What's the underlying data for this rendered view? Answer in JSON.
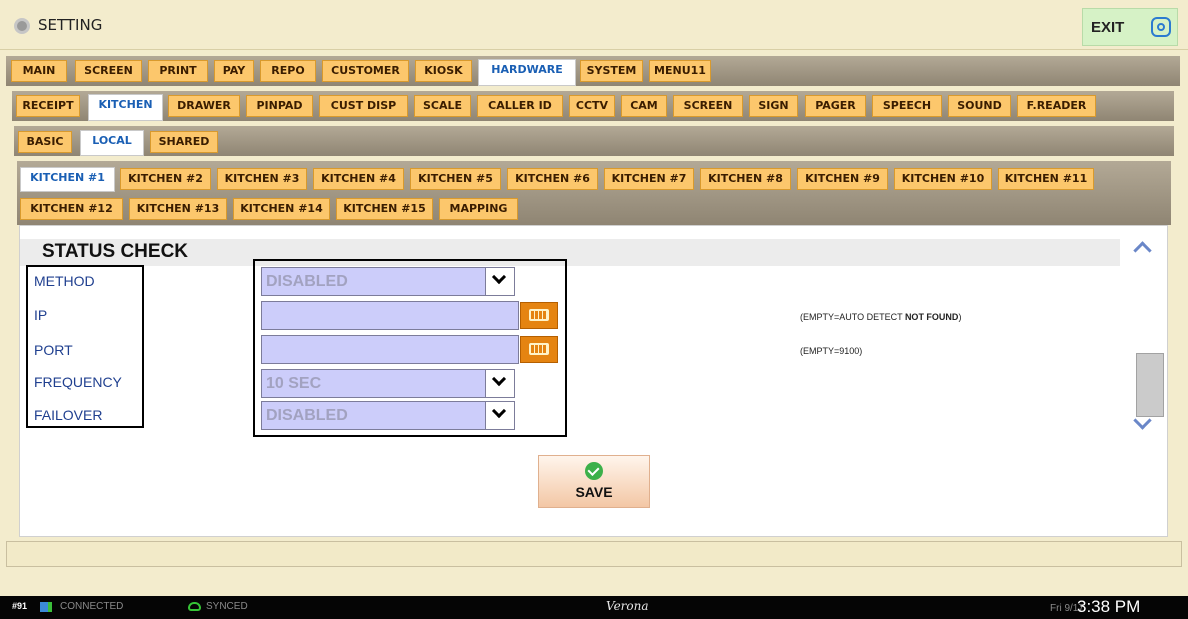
{
  "window": {
    "title": "SETTING",
    "exit_label": "EXIT"
  },
  "tabs_main": [
    {
      "label": "MAIN"
    },
    {
      "label": "SCREEN"
    },
    {
      "label": "PRINT"
    },
    {
      "label": "PAY"
    },
    {
      "label": "REPO"
    },
    {
      "label": "CUSTOMER"
    },
    {
      "label": "KIOSK"
    },
    {
      "label": "HARDWARE",
      "active": true
    },
    {
      "label": "SYSTEM"
    },
    {
      "label": "MENU11"
    }
  ],
  "tabs_hardware": [
    {
      "label": "RECEIPT"
    },
    {
      "label": "KITCHEN",
      "active": true
    },
    {
      "label": "DRAWER"
    },
    {
      "label": "PINPAD"
    },
    {
      "label": "CUST DISP"
    },
    {
      "label": "SCALE"
    },
    {
      "label": "CALLER ID"
    },
    {
      "label": "CCTV"
    },
    {
      "label": "CAM"
    },
    {
      "label": "SCREEN"
    },
    {
      "label": "SIGN"
    },
    {
      "label": "PAGER"
    },
    {
      "label": "SPEECH"
    },
    {
      "label": "SOUND"
    },
    {
      "label": "F.READER"
    }
  ],
  "tabs_kitchen": [
    {
      "label": "BASIC"
    },
    {
      "label": "LOCAL",
      "active": true
    },
    {
      "label": "SHARED"
    }
  ],
  "tabs_printer": [
    {
      "label": "KITCHEN #1",
      "active": true
    },
    {
      "label": "KITCHEN #2"
    },
    {
      "label": "KITCHEN #3"
    },
    {
      "label": "KITCHEN #4"
    },
    {
      "label": "KITCHEN #5"
    },
    {
      "label": "KITCHEN #6"
    },
    {
      "label": "KITCHEN #7"
    },
    {
      "label": "KITCHEN #8"
    },
    {
      "label": "KITCHEN #9"
    },
    {
      "label": "KITCHEN #10"
    },
    {
      "label": "KITCHEN #11"
    },
    {
      "label": "KITCHEN #12"
    },
    {
      "label": "KITCHEN #13"
    },
    {
      "label": "KITCHEN #14"
    },
    {
      "label": "KITCHEN #15"
    },
    {
      "label": "MAPPING"
    }
  ],
  "form": {
    "section_title": "STATUS CHECK",
    "labels": {
      "method": "METHOD",
      "ip": "IP",
      "port": "PORT",
      "frequency": "FREQUENCY",
      "failover": "FAILOVER"
    },
    "values": {
      "method": "DISABLED",
      "ip": "",
      "port": "",
      "frequency": "10 SEC",
      "failover": "DISABLED"
    },
    "hints": {
      "ip_prefix": "(EMPTY=AUTO DETECT ",
      "ip_bold": "NOT FOUND",
      "ip_suffix": ")",
      "port": "(EMPTY=9100)"
    },
    "save_label": "SAVE"
  },
  "status_bar": {
    "station": "#91",
    "connection": "CONNECTED",
    "sync": "SYNCED",
    "brand": "Verona",
    "date": "Fri 9/17",
    "time": "3:38 PM"
  },
  "colors": {
    "tab": "#fcc76c",
    "tab_active_text": "#1a5fb4",
    "field": "#cccdfa",
    "label_text": "#1f3f8f",
    "keyboard_btn": "#e58411"
  },
  "icons": {
    "title": "gear-icon",
    "exit": "screenshot-icon",
    "keyboard": "keyboard-icon",
    "save": "check-circle-icon",
    "connection": "network-icon",
    "sync": "cloud-icon"
  }
}
